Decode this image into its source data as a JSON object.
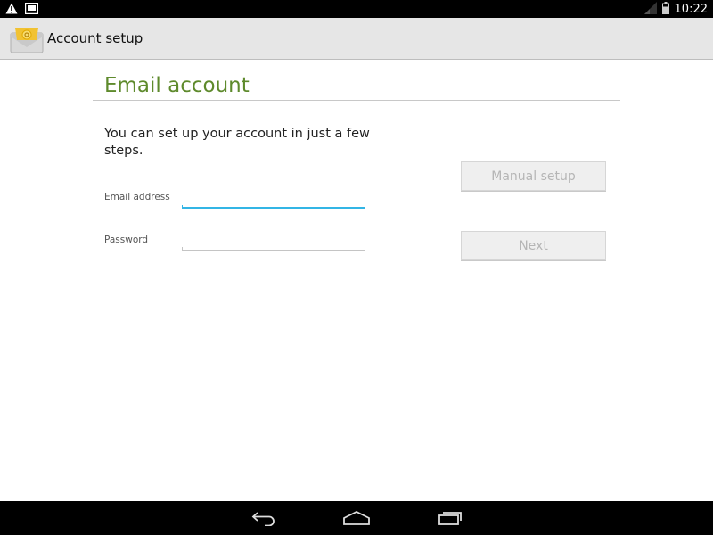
{
  "status_bar": {
    "time": "10:22",
    "left_icons": [
      "warning-icon",
      "screenshot-icon"
    ],
    "right_icons": [
      "signal-icon",
      "battery-icon"
    ]
  },
  "action_bar": {
    "title": "Account setup",
    "icon": "email-app-icon"
  },
  "page": {
    "heading": "Email account",
    "intro": "You can set up your account in just a few steps."
  },
  "form": {
    "email_label": "Email address",
    "email_value": "",
    "password_label": "Password",
    "password_value": ""
  },
  "buttons": {
    "manual_setup": "Manual setup",
    "next": "Next"
  },
  "nav_bar": {
    "icons": [
      "back-icon",
      "home-icon",
      "recent-apps-icon"
    ]
  },
  "colors": {
    "heading": "#5e8a2c",
    "focus_underline": "#33b5e5",
    "action_bar_bg": "#e6e6e6",
    "disabled_text": "#b5b5b5"
  }
}
